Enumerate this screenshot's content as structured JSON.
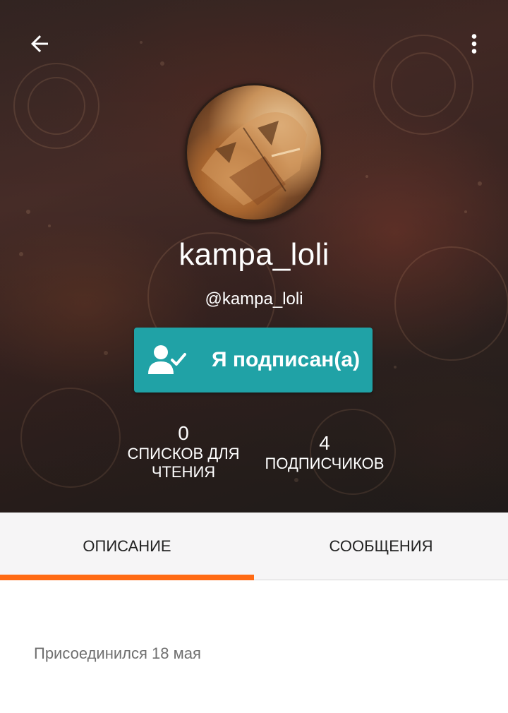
{
  "header": {
    "back_icon": "arrow-left-icon",
    "menu_icon": "more-vertical-icon"
  },
  "profile": {
    "display_name": "kampa_loli",
    "handle": "@kampa_loli",
    "follow_button": {
      "label": "Я подписан(а)",
      "icon": "user-check-icon",
      "color": "#20a2a6"
    }
  },
  "stats": {
    "reading_lists": {
      "count": "0",
      "label": "СПИСКОВ ДЛЯ ЧТЕНИЯ"
    },
    "followers": {
      "count": "4",
      "label": "ПОДПИСЧИКОВ"
    }
  },
  "tabs": [
    {
      "label": "ОПИСАНИЕ",
      "active": true
    },
    {
      "label": "СООБЩЕНИЯ",
      "active": false
    }
  ],
  "accent_color": "#ff6a14",
  "about": {
    "joined_text": "Присоединился 18 мая"
  }
}
